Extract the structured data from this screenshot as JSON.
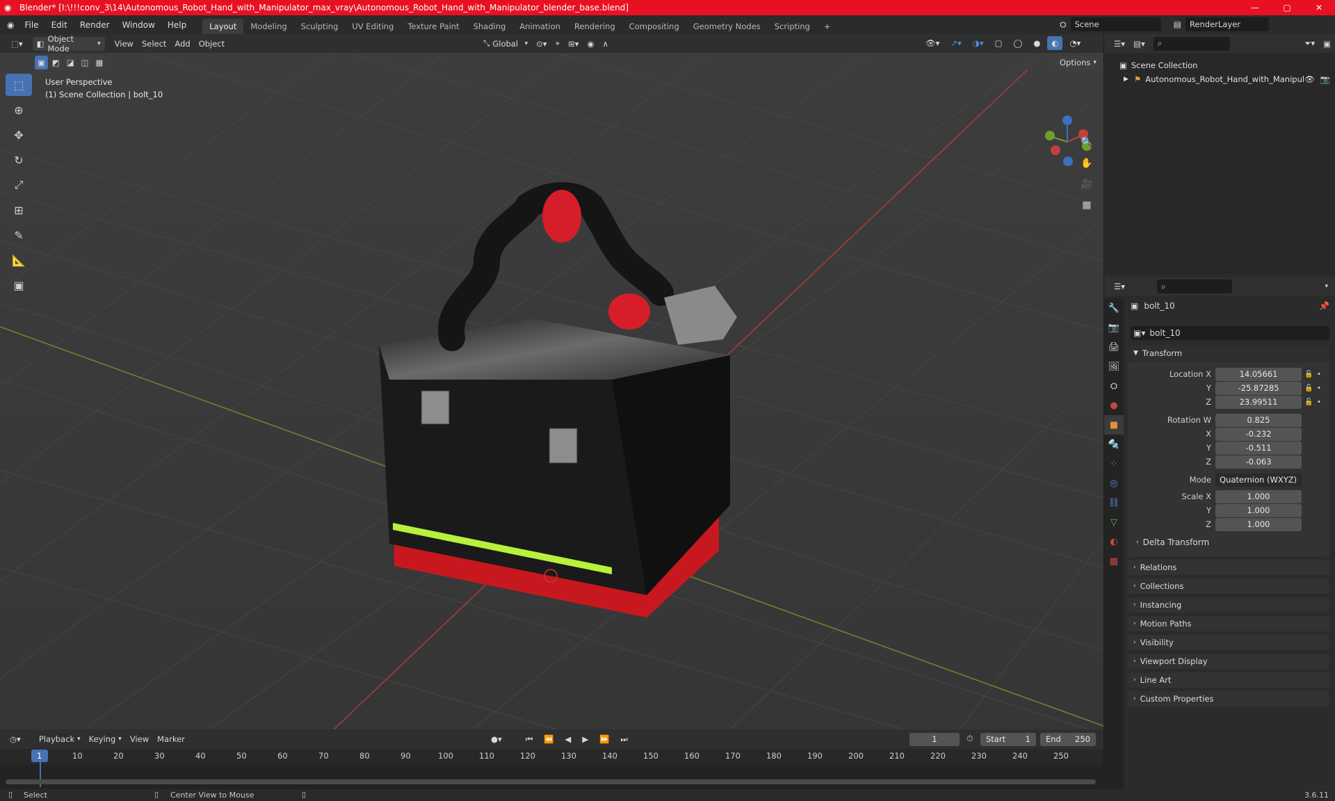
{
  "window": {
    "title": "Blender* [I:\\!!!conv_3\\14\\Autonomous_Robot_Hand_with_Manipulator_max_vray\\Autonomous_Robot_Hand_with_Manipulator_blender_base.blend]",
    "minimize": "—",
    "maximize": "▢",
    "close": "✕"
  },
  "menu": {
    "items": [
      "File",
      "Edit",
      "Render",
      "Window",
      "Help"
    ],
    "workspaces": [
      "Layout",
      "Modeling",
      "Sculpting",
      "UV Editing",
      "Texture Paint",
      "Shading",
      "Animation",
      "Rendering",
      "Compositing",
      "Geometry Nodes",
      "Scripting"
    ],
    "active_workspace": "Layout",
    "add_workspace": "+",
    "scene_label": "Scene",
    "renderlayer_label": "RenderLayer"
  },
  "viewport_header": {
    "mode": "Object Mode",
    "menus": [
      "View",
      "Select",
      "Add",
      "Object"
    ],
    "orientation": "Global",
    "options": "Options"
  },
  "viewport": {
    "perspective": "User Perspective",
    "collection_info": "(1) Scene Collection | bolt_10",
    "gizmo": {
      "x": "X",
      "y": "Y",
      "z": "Z"
    }
  },
  "outliner": {
    "root": "Scene Collection",
    "item": "Autonomous_Robot_Hand_with_Manipul"
  },
  "properties": {
    "object_name": "bolt_10",
    "data_name": "bolt_10",
    "transform_title": "Transform",
    "location": {
      "label": "Location X",
      "x": "14.05661",
      "y": "-25.87285",
      "z": "23.99511"
    },
    "rotation": {
      "label": "Rotation W",
      "w": "0.825",
      "x": "-0.232",
      "y": "-0.511",
      "z": "-0.063"
    },
    "mode_label": "Mode",
    "mode_value": "Quaternion (WXYZ)",
    "scale": {
      "label": "Scale X",
      "x": "1.000",
      "y": "1.000",
      "z": "1.000"
    },
    "axis": {
      "y": "Y",
      "z": "Z",
      "x": "X"
    },
    "delta": "Delta Transform",
    "sections": [
      "Relations",
      "Collections",
      "Instancing",
      "Motion Paths",
      "Visibility",
      "Viewport Display",
      "Line Art",
      "Custom Properties"
    ]
  },
  "timeline": {
    "menus": [
      "Playback",
      "Keying",
      "View",
      "Marker"
    ],
    "current_frame": "1",
    "start_label": "Start",
    "start": "1",
    "end_label": "End",
    "end": "250",
    "ticks": [
      "1",
      "10",
      "20",
      "30",
      "40",
      "50",
      "60",
      "70",
      "80",
      "90",
      "100",
      "110",
      "120",
      "130",
      "140",
      "150",
      "160",
      "170",
      "180",
      "190",
      "200",
      "210",
      "220",
      "230",
      "240",
      "250"
    ]
  },
  "status": {
    "select": "Select",
    "center": "Center View to Mouse",
    "version": "3.6.11"
  },
  "colors": {
    "accent": "#4772b3",
    "titlebar": "#e81123",
    "x_axis": "#c0392b",
    "y_axis": "#7fa02a"
  }
}
